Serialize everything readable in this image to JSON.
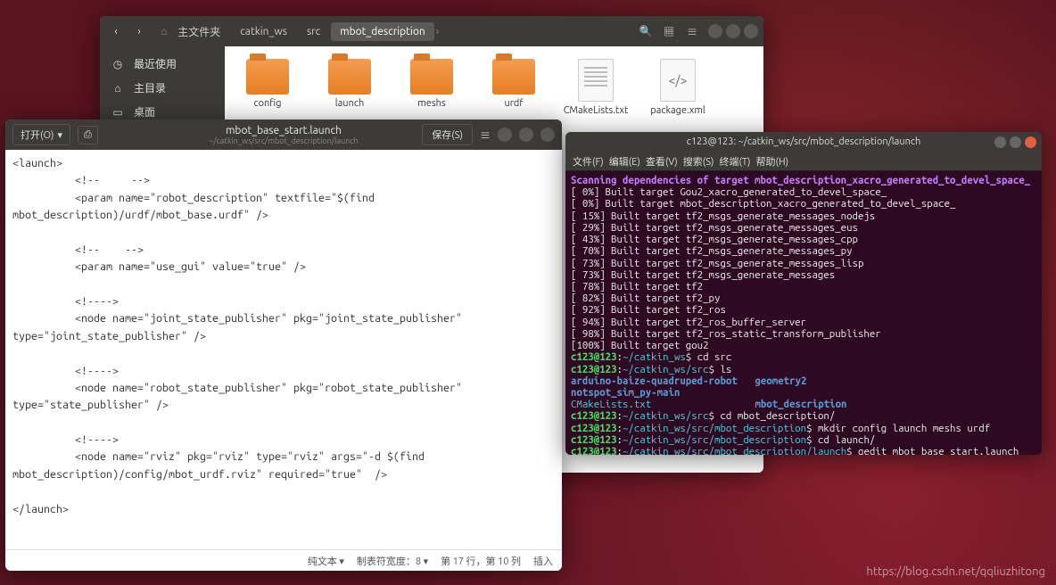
{
  "fileManager": {
    "breadcrumbs": [
      "主文件夹",
      "catkin_ws",
      "src",
      "mbot_description"
    ],
    "activeCrumbIndex": 3,
    "sidebar": [
      {
        "icon": "recent",
        "label": "最近使用"
      },
      {
        "icon": "home",
        "label": "主目录"
      },
      {
        "icon": "desktop",
        "label": "桌面"
      }
    ],
    "items": [
      {
        "type": "folder",
        "label": "config"
      },
      {
        "type": "folder",
        "label": "launch"
      },
      {
        "type": "folder",
        "label": "meshs"
      },
      {
        "type": "folder",
        "label": "urdf"
      },
      {
        "type": "file-txt",
        "label": "CMakeLists.txt"
      },
      {
        "type": "file-xml",
        "label": "package.xml"
      }
    ]
  },
  "gedit": {
    "openLabel": "打开(O)",
    "saveLabel": "保存(S)",
    "title": "mbot_base_start.launch",
    "subtitle": "~/catkin_ws/src/mbot_description/launch",
    "content": "<launch>\n          <!--     -->\n          <param name=\"robot_description\" textfile=\"$(find  mbot_description)/urdf/mbot_base.urdf\" />\n\n          <!--    -->\n          <param name=\"use_gui\" value=\"true\" />\n\n          <!---->\n          <node name=\"joint_state_publisher\" pkg=\"joint_state_publisher\" type=\"joint_state_publisher\" />\n\n          <!---->\n          <node name=\"robot_state_publisher\" pkg=\"robot_state_publisher\" type=\"state_publisher\" />\n\n          <!---->\n          <node name=\"rviz\" pkg=\"rviz\" type=\"rviz\" args=\"-d $(find mbot_description)/config/mbot_urdf.rviz\" required=\"true\"  />\n\n</launch>",
    "status": {
      "mode": "纯文本 ▾",
      "tabw": "制表符宽度：8 ▾",
      "pos": "第 17 行，第 10 列",
      "ins": "插入"
    }
  },
  "terminal": {
    "title": "c123@123: ~/catkin_ws/src/mbot_description/launch",
    "menus": [
      "文件(F)",
      "编辑(E)",
      "查看(V)",
      "搜索(S)",
      "终端(T)",
      "帮助(H)"
    ],
    "scanLine": "Scanning dependencies of target mbot_description_xacro_generated_to_devel_space_",
    "builds": [
      {
        "pct": "  0%",
        "target": "Gou2_xacro_generated_to_devel_space_"
      },
      {
        "pct": "  0%",
        "target": "mbot_description_xacro_generated_to_devel_space_"
      },
      {
        "pct": " 15%",
        "target": "tf2_msgs_generate_messages_nodejs"
      },
      {
        "pct": " 29%",
        "target": "tf2_msgs_generate_messages_eus"
      },
      {
        "pct": " 43%",
        "target": "tf2_msgs_generate_messages_cpp"
      },
      {
        "pct": " 70%",
        "target": "tf2_msgs_generate_messages_py"
      },
      {
        "pct": " 73%",
        "target": "tf2_msgs_generate_messages_lisp"
      },
      {
        "pct": " 73%",
        "target": "tf2_msgs_generate_messages"
      },
      {
        "pct": " 78%",
        "target": "tf2"
      },
      {
        "pct": " 82%",
        "target": "tf2_py"
      },
      {
        "pct": " 92%",
        "target": "tf2_ros"
      },
      {
        "pct": " 94%",
        "target": "tf2_ros_buffer_server"
      },
      {
        "pct": " 98%",
        "target": "tf2_ros_static_transform_publisher"
      },
      {
        "pct": "100%",
        "target": "gou2"
      }
    ],
    "prompts": [
      {
        "user": "c123@123",
        "path": "~/catkin_ws",
        "cmd": "cd src"
      },
      {
        "user": "c123@123",
        "path": "~/catkin_ws/src",
        "cmd": "ls"
      }
    ],
    "lsOutput": [
      {
        "text": "arduino-baize-quadruped-robot",
        "cls": "blue2"
      },
      {
        "text": "geometry2",
        "cls": "blue2"
      },
      {
        "text": "notspot_sim_py-main",
        "cls": "blue2"
      }
    ],
    "lsOutput2": [
      {
        "text": "CMakeLists.txt",
        "cls": "cyan"
      },
      {
        "text": "mbot_description",
        "cls": "blue2"
      }
    ],
    "prompts2": [
      {
        "user": "c123@123",
        "path": "~/catkin_ws/src",
        "cmd": "cd mbot_description/"
      },
      {
        "user": "c123@123",
        "path": "~/catkin_ws/src/mbot_description",
        "cmd": "mkdir config launch meshs urdf"
      },
      {
        "user": "c123@123",
        "path": "~/catkin_ws/src/mbot_description",
        "cmd": "cd launch/"
      },
      {
        "user": "c123@123",
        "path": "~/catkin_ws/src/mbot_description/launch",
        "cmd": "gedit mbot_base_start.launch"
      }
    ]
  },
  "watermark": "https://blog.csdn.net/qqliuzhitong"
}
